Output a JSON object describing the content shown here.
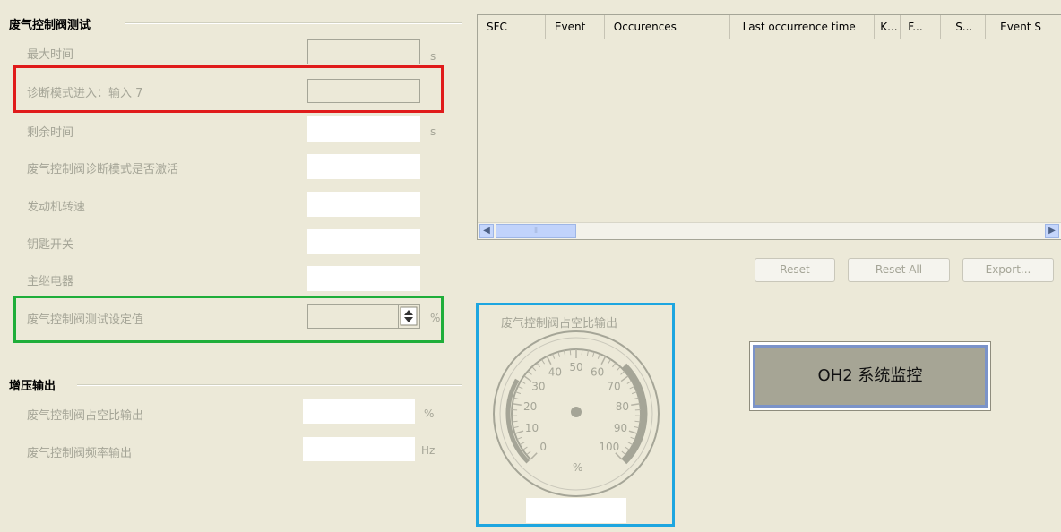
{
  "left_group": {
    "title": "废气控制阀测试",
    "rows": [
      {
        "label": "最大时间",
        "unit": "s"
      },
      {
        "label": "诊断模式进入：输入 7",
        "unit": ""
      },
      {
        "label": "剩余时间",
        "unit": "s"
      },
      {
        "label": "废气控制阀诊断模式是否激活",
        "unit": ""
      },
      {
        "label": "发动机转速",
        "unit": ""
      },
      {
        "label": "钥匙开关",
        "unit": ""
      },
      {
        "label": "主继电器",
        "unit": ""
      },
      {
        "label": "废气控制阀测试设定值",
        "unit": "%"
      }
    ]
  },
  "boost_group": {
    "title": "增压输出",
    "rows": [
      {
        "label": "废气控制阀占空比输出",
        "unit": "%"
      },
      {
        "label": "废气控制阀频率输出",
        "unit": "Hz"
      }
    ]
  },
  "event_grid": {
    "columns": [
      "SFC",
      "Event",
      "Occurences",
      "Last occurrence time",
      "K...",
      "F...",
      "S...",
      "Event S"
    ]
  },
  "buttons": {
    "reset": "Reset",
    "reset_all": "Reset All",
    "export": "Export..."
  },
  "gauge": {
    "title": "废气控制阀占空比输出",
    "ticks": [
      "0",
      "10",
      "20",
      "30",
      "40",
      "50",
      "60",
      "70",
      "80",
      "90",
      "100"
    ],
    "unit": "%",
    "value_text": ""
  },
  "oh2_button": {
    "label": "OH2 系统监控"
  },
  "highlight_colors": {
    "red": "#e01b1b",
    "green": "#1fae3a",
    "blue": "#1ea6e0"
  }
}
